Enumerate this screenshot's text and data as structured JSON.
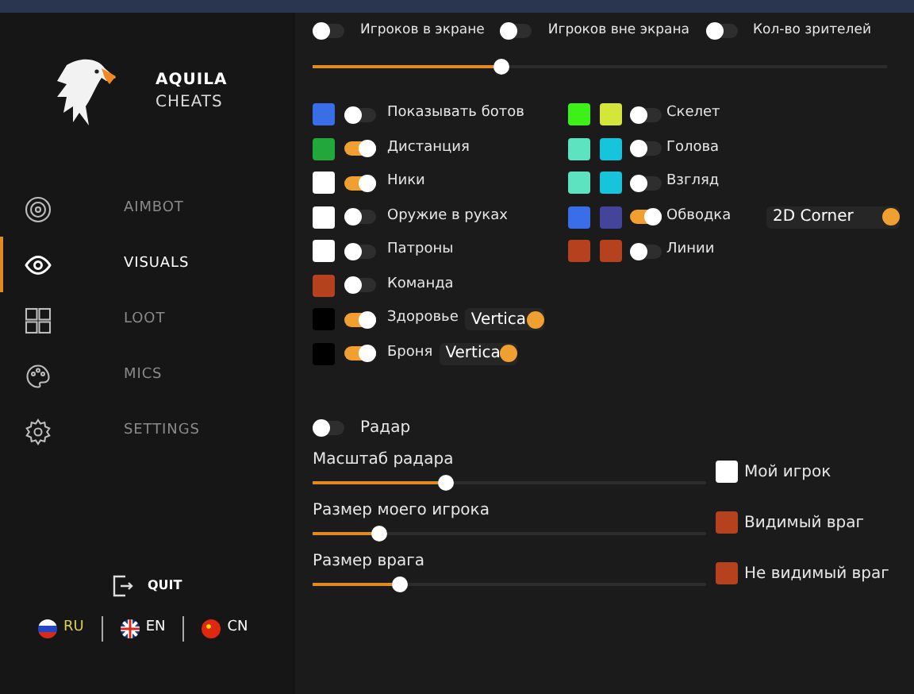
{
  "brand": {
    "name": "AQUILA",
    "subtitle": "CHEATS"
  },
  "nav": [
    {
      "label": "AIMBOT",
      "selected": false
    },
    {
      "label": "VISUALS",
      "selected": true
    },
    {
      "label": "LOOT",
      "selected": false
    },
    {
      "label": "MICS",
      "selected": false
    },
    {
      "label": "SETTINGS",
      "selected": false
    }
  ],
  "quit": "QUIT",
  "languages": [
    {
      "code": "RU",
      "selected": true
    },
    {
      "code": "EN",
      "selected": false
    },
    {
      "code": "CN",
      "selected": false
    }
  ],
  "top_toggles": [
    {
      "label": "Игроков в экране",
      "on": false
    },
    {
      "label": "Игроков вне экрана",
      "on": false
    },
    {
      "label": "Кол-во зрителей",
      "on": false
    }
  ],
  "top_slider": {
    "level": 0.33
  },
  "left_options": [
    {
      "color": "#3a6ee8",
      "label": "Показывать ботов",
      "on": false
    },
    {
      "color": "#22a83a",
      "label": "Дистанция",
      "on": true
    },
    {
      "color": "#ffffff",
      "label": "Ники",
      "on": true
    },
    {
      "color": "#ffffff",
      "label": "Оружие в руках",
      "on": false
    },
    {
      "color": "#ffffff",
      "label": "Патроны",
      "on": false
    },
    {
      "color": "#b5411f",
      "label": "Команда",
      "on": false
    },
    {
      "color": "#000000",
      "label": "Здоровье",
      "on": true,
      "dropdown": "Vertica"
    },
    {
      "color": "#000000",
      "label": "Броня",
      "on": true,
      "dropdown": "Vertica"
    }
  ],
  "right_options": [
    {
      "swatches": [
        {
          "color": "#3ef01a"
        },
        {
          "color": "#d4e63a"
        }
      ],
      "label": "Скелет",
      "on": false
    },
    {
      "swatches": [
        {
          "color": "#5ee3c0"
        },
        {
          "color": "#16c4dc"
        }
      ],
      "label": "Голова",
      "on": false
    },
    {
      "swatches": [
        {
          "color": "#5ee3c0"
        },
        {
          "color": "#16c4dc"
        }
      ],
      "label": "Взгляд",
      "on": false
    },
    {
      "swatches": [
        {
          "color": "#3a6ee8"
        },
        {
          "color": "#44449a"
        }
      ],
      "label": "Обводка",
      "on": true,
      "dropdown": "2D Corner"
    },
    {
      "swatches": [
        {
          "color": "#b5411f"
        },
        {
          "color": "#b5411f"
        }
      ],
      "label": "Линии",
      "on": false
    }
  ],
  "radar": {
    "label": "Радар",
    "on": false
  },
  "radar_sliders": [
    {
      "label": "Масштаб радара",
      "level": 0.34
    },
    {
      "label": "Размер моего игрока",
      "level": 0.17
    },
    {
      "label": "Размер врага",
      "level": 0.22
    }
  ],
  "legend": [
    {
      "label": "Мой игрок",
      "color": "#ffffff"
    },
    {
      "label": "Видимый враг",
      "color": "#b5411f"
    },
    {
      "label": "Не видимый враг",
      "color": "#b5411f"
    }
  ]
}
